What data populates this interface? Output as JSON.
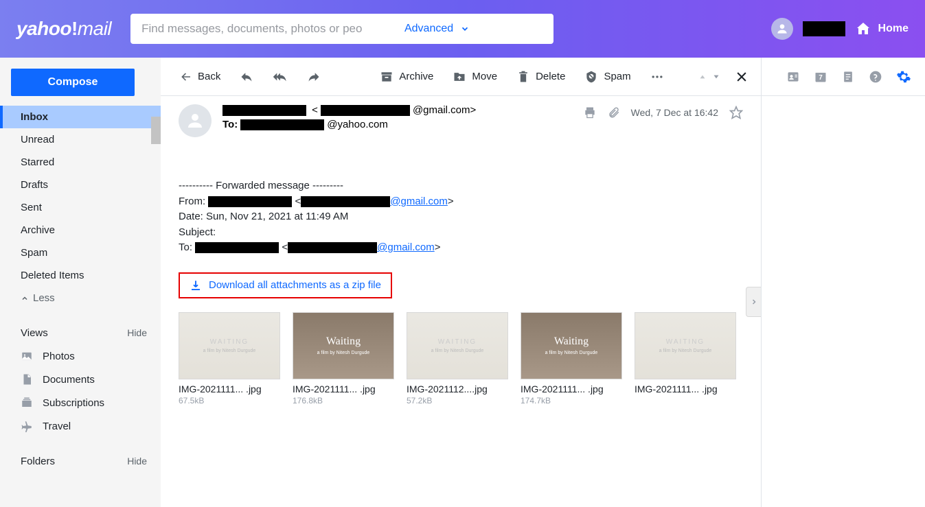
{
  "logo": {
    "brand": "yahoo",
    "sep": "!",
    "product": "mail"
  },
  "search": {
    "placeholder": "Find messages, documents, photos or peo",
    "advanced": "Advanced"
  },
  "home_label": "Home",
  "compose": "Compose",
  "folders": [
    {
      "label": "Inbox",
      "active": true
    },
    {
      "label": "Unread",
      "active": false
    },
    {
      "label": "Starred",
      "active": false
    },
    {
      "label": "Drafts",
      "active": false
    },
    {
      "label": "Sent",
      "active": false
    },
    {
      "label": "Archive",
      "active": false
    },
    {
      "label": "Spam",
      "active": false
    },
    {
      "label": "Deleted Items",
      "active": false
    }
  ],
  "less_label": "Less",
  "views_header": {
    "title": "Views",
    "hide": "Hide"
  },
  "views": [
    {
      "label": "Photos",
      "icon": "image"
    },
    {
      "label": "Documents",
      "icon": "doc"
    },
    {
      "label": "Subscriptions",
      "icon": "sub"
    },
    {
      "label": "Travel",
      "icon": "plane"
    }
  ],
  "folders_header": {
    "title": "Folders",
    "hide": "Hide"
  },
  "toolbar": {
    "back": "Back",
    "archive": "Archive",
    "move": "Move",
    "delete": "Delete",
    "spam": "Spam"
  },
  "message": {
    "from_suffix": "@gmail.com>",
    "to_prefix": "To:",
    "to_suffix": "@yahoo.com",
    "date": "Wed, 7 Dec at 16:42",
    "forwarded": {
      "header": "---------- Forwarded message ---------",
      "from_label": "From:",
      "from_open": " <",
      "from_link": "@gmail.com",
      "from_close": ">",
      "date_label": "Date: ",
      "date_value": "Sun, Nov 21, 2021 at 11:49 AM",
      "subject_label": "Subject:",
      "to_label": "To:",
      "to_open": " <",
      "to_link": "@gmail.com",
      "to_close": ">"
    },
    "download_all": "Download all attachments as a zip file",
    "attachments": [
      {
        "name": "IMG-2021111... .jpg",
        "size": "67.5kB",
        "style": "light"
      },
      {
        "name": "IMG-2021111... .jpg",
        "size": "176.8kB",
        "style": "dark"
      },
      {
        "name": "IMG-2021112....jpg",
        "size": "57.2kB",
        "style": "light"
      },
      {
        "name": "IMG-2021111... .jpg",
        "size": "174.7kB",
        "style": "dark"
      },
      {
        "name": "IMG-2021111... .jpg",
        "size": "",
        "style": "light"
      }
    ]
  },
  "calendar_badge": "7"
}
